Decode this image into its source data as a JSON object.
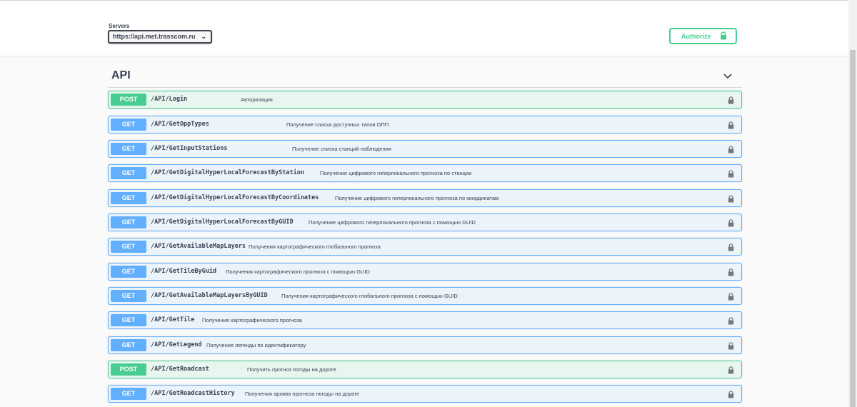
{
  "servers": {
    "label": "Servers",
    "selected": "https://api.met.trasscom.ru"
  },
  "authorize": {
    "label": "Authorize",
    "icon": "lock-icon"
  },
  "tag": {
    "title": "API",
    "icon": "chevron-down-icon"
  },
  "colors": {
    "get": "#61affe",
    "post": "#49cc90"
  },
  "operations": [
    {
      "method": "POST",
      "path": "/API/Login",
      "summary": "Авторизация"
    },
    {
      "method": "GET",
      "path": "/API/GetOppTypes",
      "summary": "Получение списка доступных типов ОПП"
    },
    {
      "method": "GET",
      "path": "/API/GetInputStations",
      "summary": "Получение списка станций наблюдения"
    },
    {
      "method": "GET",
      "path": "/API/GetDigitalHyperLocalForecastByStation",
      "summary": "Получение цифрового гиперлокального прогноза по станции"
    },
    {
      "method": "GET",
      "path": "/API/GetDigitalHyperLocalForecastByCoordinates",
      "summary": "Получение цифрового гиперлокального прогноза по координатам"
    },
    {
      "method": "GET",
      "path": "/API/GetDigitalHyperLocalForecastByGUID",
      "summary": "Получение цифрового гиперлокального прогноза с помощью GUID"
    },
    {
      "method": "GET",
      "path": "/API/GetAvailableMapLayers",
      "summary": "Получения картографического глобального прогноза"
    },
    {
      "method": "GET",
      "path": "/API/GetTileByGuid",
      "summary": "Получения картографического прогноза с помощью GUID"
    },
    {
      "method": "GET",
      "path": "/API/GetAvailableMapLayersByGUID",
      "summary": "Получения картографического глобального прогноза с помощью GUID"
    },
    {
      "method": "GET",
      "path": "/API/GetTile",
      "summary": "Получения картографического прогноза"
    },
    {
      "method": "GET",
      "path": "/API/GetLegend",
      "summary": "Получения легенды по идентификатору"
    },
    {
      "method": "POST",
      "path": "/API/GetRoadcast",
      "summary": "Получить прогноз погоды на дороге"
    },
    {
      "method": "GET",
      "path": "/API/GetRoadcastHistory",
      "summary": "Получения архива прогноза погоды на дороге"
    }
  ]
}
